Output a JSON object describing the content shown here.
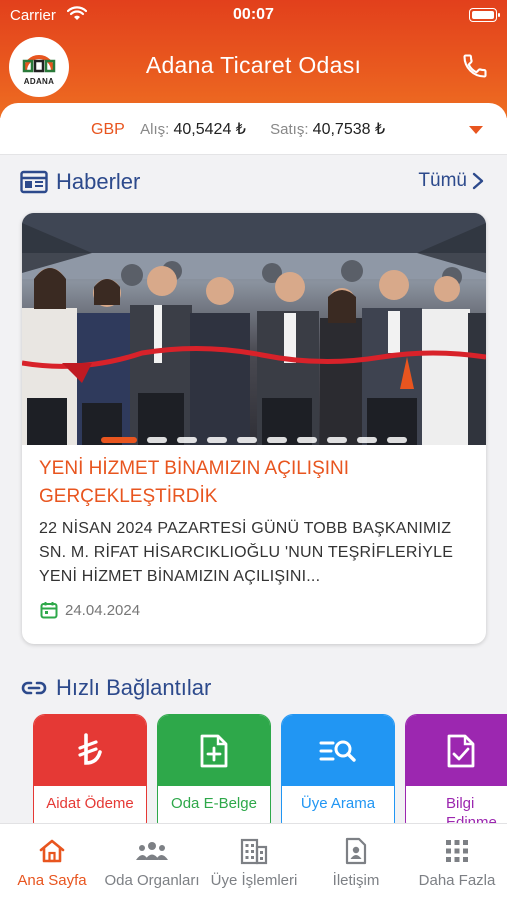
{
  "status": {
    "carrier": "Carrier",
    "time": "00:07"
  },
  "header": {
    "title": "Adana Ticaret Odası",
    "logo_text": "ADANA"
  },
  "currency": {
    "code": "GBP",
    "buy_label": "Alış:",
    "buy_value": "40,5424 ₺",
    "sell_label": "Satış:",
    "sell_value": "40,7538 ₺"
  },
  "news": {
    "section_title": "Haberler",
    "all_label": "Tümü",
    "title": "YENİ HİZMET BİNAMIZIN AÇILIŞINI GERÇEKLEŞTİRDİK",
    "body": "22 NİSAN 2024 PAZARTESİ GÜNÜ TOBB BAŞKANIMIZ SN. M. RİFAT HİSARCIKLIOĞLU 'NUN TEŞRİFLERİYLE YENİ HİZMET BİNAMIZIN AÇILIŞINI...",
    "date": "24.04.2024"
  },
  "quick_links": {
    "section_title": "Hızlı Bağlantılar",
    "items": [
      {
        "label": "Aidat Ödeme",
        "color": "#e53935",
        "icon": "lira-icon"
      },
      {
        "label": "Oda E-Belge",
        "color": "#2ea84a",
        "icon": "document-plus-icon"
      },
      {
        "label": "Üye Arama",
        "color": "#2196f3",
        "icon": "search-list-icon"
      },
      {
        "label": "Bilgi Edinme",
        "color": "#9c27b0",
        "icon": "document-check-icon"
      }
    ]
  },
  "tabs": [
    {
      "label": "Ana Sayfa",
      "icon": "home-icon",
      "active": true
    },
    {
      "label": "Oda Organları",
      "icon": "group-icon"
    },
    {
      "label": "Üye İşlemleri",
      "icon": "building-icon"
    },
    {
      "label": "İletişim",
      "icon": "contact-icon"
    },
    {
      "label": "Daha Fazla",
      "icon": "grid-icon"
    }
  ],
  "colors": {
    "accent": "#e8551f",
    "header": "#e2401c",
    "section": "#2d4a8c"
  }
}
